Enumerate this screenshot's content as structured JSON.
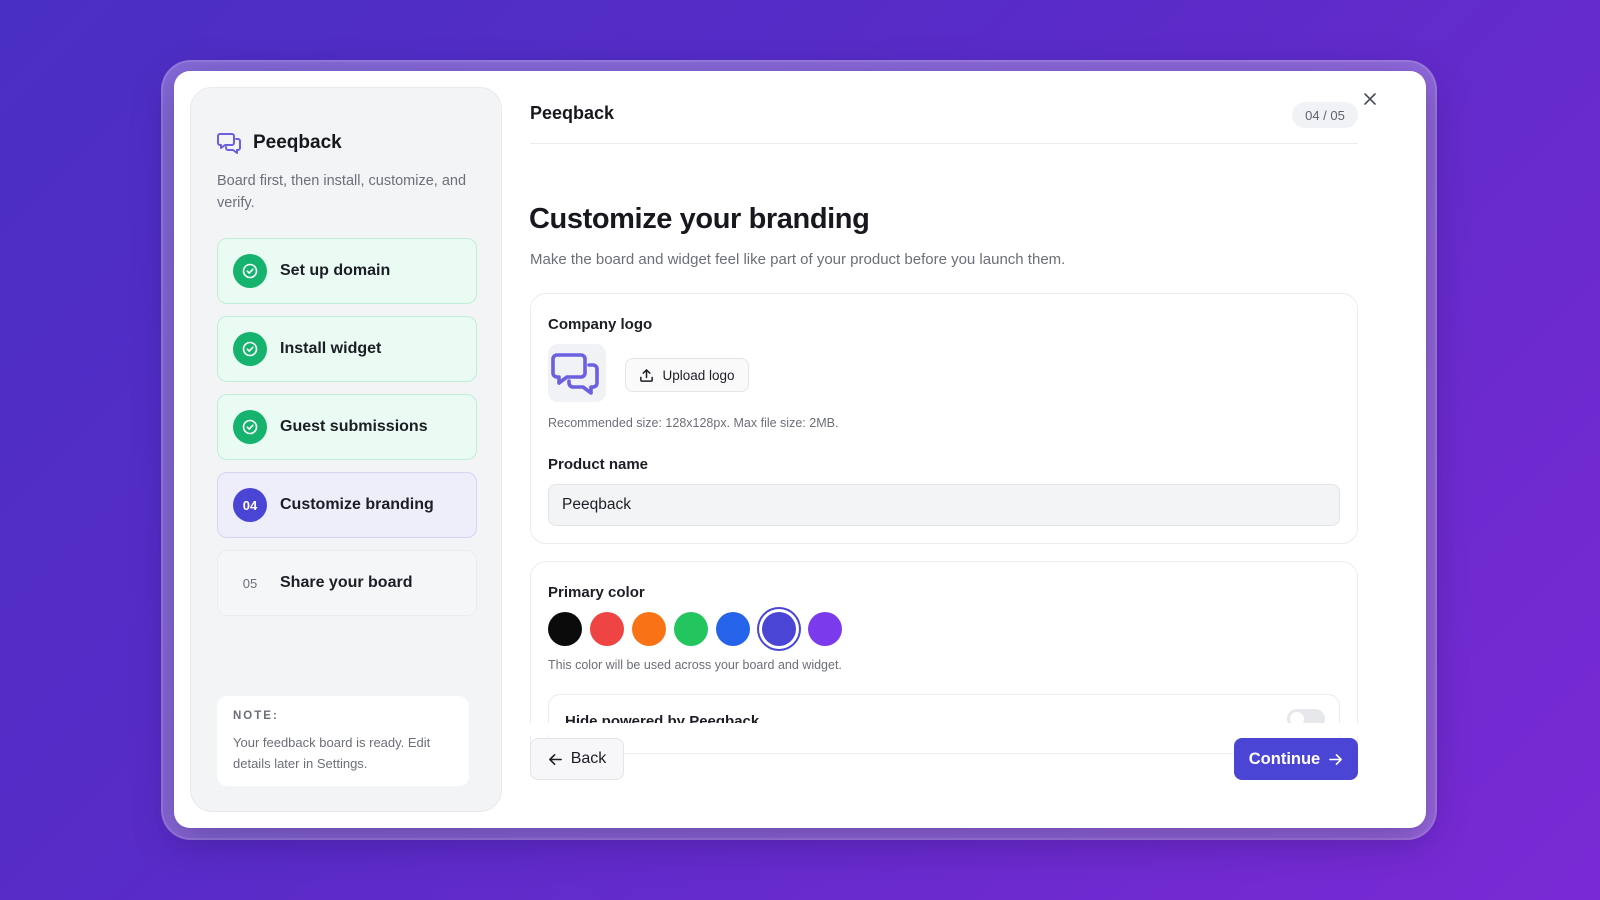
{
  "sidebar": {
    "brand_name": "Peeqback",
    "tagline": "Board first, then install, customize, and verify.",
    "steps": [
      {
        "badge": "",
        "label": "Set up domain",
        "state": "done"
      },
      {
        "badge": "",
        "label": "Install widget",
        "state": "done"
      },
      {
        "badge": "",
        "label": "Guest submissions",
        "state": "done"
      },
      {
        "badge": "04",
        "label": "Customize branding",
        "state": "active"
      },
      {
        "badge": "05",
        "label": "Share your board",
        "state": "pending"
      }
    ],
    "note": {
      "title": "NOTE:",
      "text": "Your feedback board is ready. Edit details later in Settings."
    }
  },
  "header": {
    "title": "Peeqback",
    "step_count": "04 / 05",
    "close_icon": "close-icon"
  },
  "main": {
    "heading": "Customize your branding",
    "subheading": "Make the board and widget feel like part of your product before you launch them.",
    "logo_section": {
      "label": "Company logo",
      "upload_label": "Upload logo",
      "hint": "Recommended size: 128x128px. Max file size: 2MB."
    },
    "product_name": {
      "label": "Product name",
      "value": "Peeqback"
    },
    "primary_color": {
      "label": "Primary color",
      "swatches": [
        "#0b0b0b",
        "#ef4444",
        "#f97316",
        "#22c55e",
        "#2563eb",
        "#4b45d6",
        "#7c3aed"
      ],
      "selected_index": 5,
      "hint": "This color will be used across your board and widget."
    },
    "hide_powered": {
      "label": "Hide powered by Peeqback",
      "enabled": false
    }
  },
  "footer": {
    "back_label": "Back",
    "continue_label": "Continue"
  },
  "colors": {
    "accent": "#4b45d6",
    "success": "#16b36f",
    "background_gradient_start": "#4a2fc4",
    "background_gradient_end": "#7a2ad4"
  }
}
